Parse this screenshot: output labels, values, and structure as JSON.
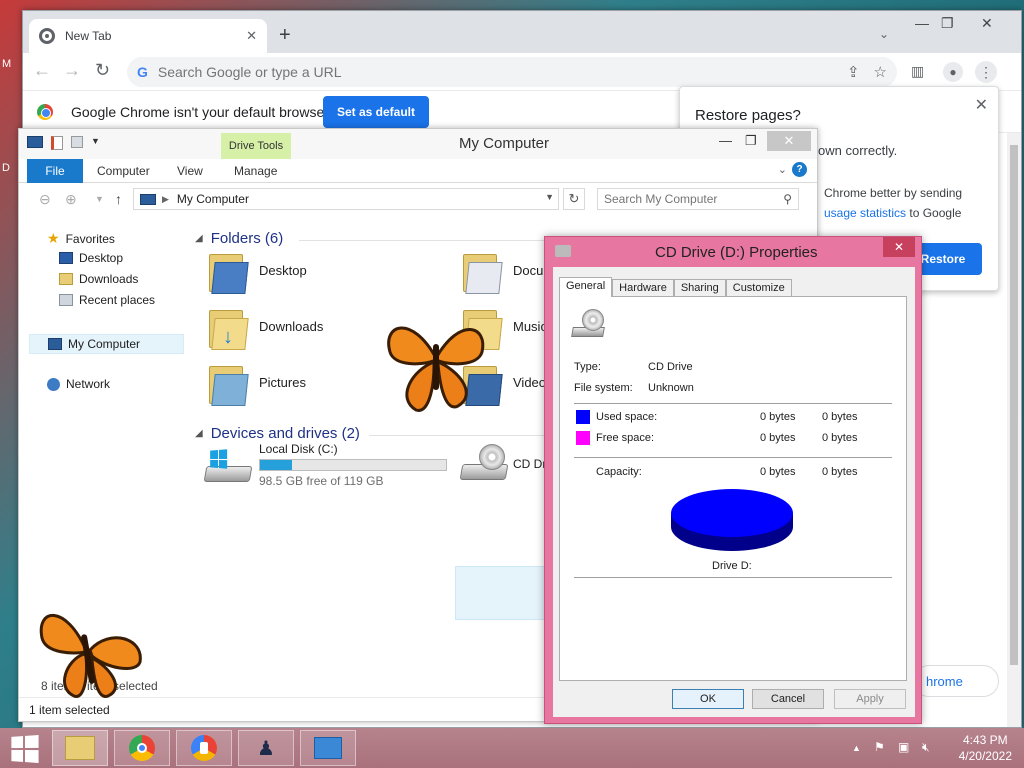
{
  "chrome": {
    "tab_title": "New Tab",
    "tab_close": "✕",
    "new_tab": "+",
    "tab_search": "⌄",
    "win_min": "—",
    "win_max": "❐",
    "win_close": "✕",
    "back": "←",
    "forward": "→",
    "reload": "↻",
    "omnibox_logo": "G",
    "omnibox_placeholder": "Search Google or type a URL",
    "infobar_message": "Google Chrome isn't your default browser",
    "set_default_label": "Set as default",
    "restore_title": "Restore pages?",
    "restore_close": "✕",
    "restore_text1": "own correctly.",
    "restore_text2a": "Chrome better by sending",
    "restore_text2b_link": "usage statistics",
    "restore_text2c": " to Google",
    "restore_button": "Restore",
    "bottom_button": "hrome"
  },
  "explorer": {
    "title": "My Computer",
    "drive_tools": "Drive Tools",
    "ctl_min": "—",
    "ctl_max": "❐",
    "ctl_close": "✕",
    "ribbon_tabs": {
      "file": "File",
      "computer": "Computer",
      "view": "View",
      "manage": "Manage"
    },
    "ribbon_chevron": "⌄",
    "help": "?",
    "address": "My Computer",
    "search_placeholder": "Search My Computer",
    "nav": {
      "favorites": "Favorites",
      "desktop": "Desktop",
      "downloads": "Downloads",
      "recent": "Recent places",
      "mycomputer": "My Computer",
      "network": "Network"
    },
    "folders_header": "Folders (6)",
    "folders": {
      "desktop": "Desktop",
      "documents": "Docum",
      "downloads": "Downloads",
      "music": "Music",
      "pictures": "Pictures",
      "videos": "Videos"
    },
    "devices_header": "Devices and drives (2)",
    "local_disk": {
      "label": "Local Disk (C:)",
      "free": "98.5 GB free of 119 GB",
      "used_fraction": 0.17
    },
    "cd_drive_label": "CD Dri",
    "count_line": "8 item    1 item selected",
    "status": "1 item selected"
  },
  "props": {
    "title": "CD Drive (D:) Properties",
    "close": "✕",
    "tabs": [
      "General",
      "Hardware",
      "Sharing",
      "Customize"
    ],
    "type_label": "Type:",
    "type_value": "CD Drive",
    "fs_label": "File system:",
    "fs_value": "Unknown",
    "used_label": "Used space:",
    "used_bytes": "0 bytes",
    "used_bytes2": "0 bytes",
    "free_label": "Free space:",
    "free_bytes": "0 bytes",
    "free_bytes2": "0 bytes",
    "cap_label": "Capacity:",
    "cap_bytes": "0 bytes",
    "cap_bytes2": "0 bytes",
    "drive_caption": "Drive D:",
    "used_color": "#0000ff",
    "free_color": "#ff00ff",
    "ok": "OK",
    "cancel": "Cancel",
    "apply": "Apply"
  },
  "taskbar": {
    "time": "4:43 PM",
    "date": "4/20/2022"
  },
  "desktop_edge": {
    "m": "M",
    "d": "D"
  }
}
